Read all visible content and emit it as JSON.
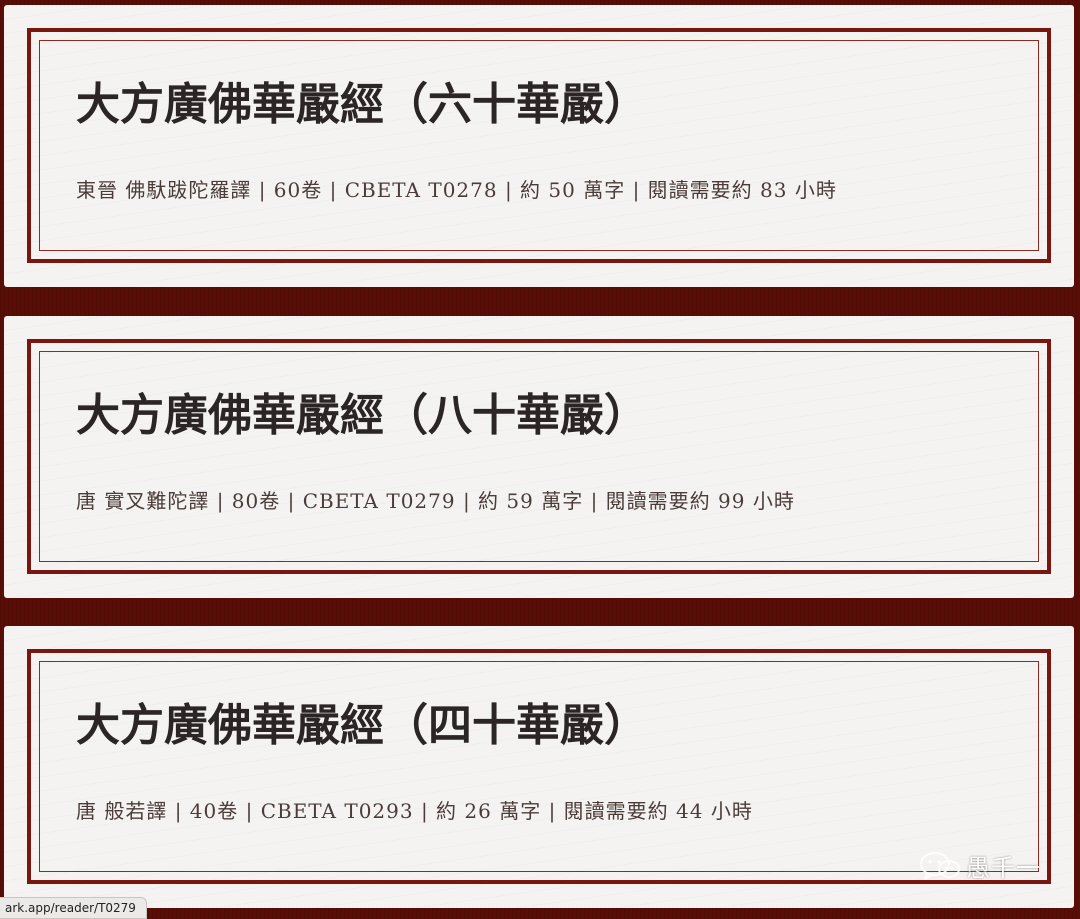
{
  "cards": [
    {
      "title": "大方廣佛華嚴經（六十華嚴）",
      "meta": "東晉 佛馱跋陀羅譯 | 60卷 | CBETA T0278 | 約 50 萬字 | 閱讀需要約 83 小時"
    },
    {
      "title": "大方廣佛華嚴經（八十華嚴）",
      "meta": "唐 實叉難陀譯 | 80卷 | CBETA T0279 | 約 59 萬字 | 閱讀需要約 99 小時"
    },
    {
      "title": "大方廣佛華嚴經（四十華嚴）",
      "meta": "唐 般若譯 | 40卷 | CBETA T0293 | 約 26 萬字 | 閱讀需要約 44 小時"
    }
  ],
  "status_bar": {
    "url": "ark.app/reader/T0279"
  },
  "watermark": {
    "icon": "wechat-icon",
    "text": "愚千一"
  },
  "colors": {
    "background": "#5a0d06",
    "card": "#f4f3f2",
    "frame": "#7a1610",
    "title_text": "#2b2625",
    "meta_text": "#4a3c38"
  }
}
